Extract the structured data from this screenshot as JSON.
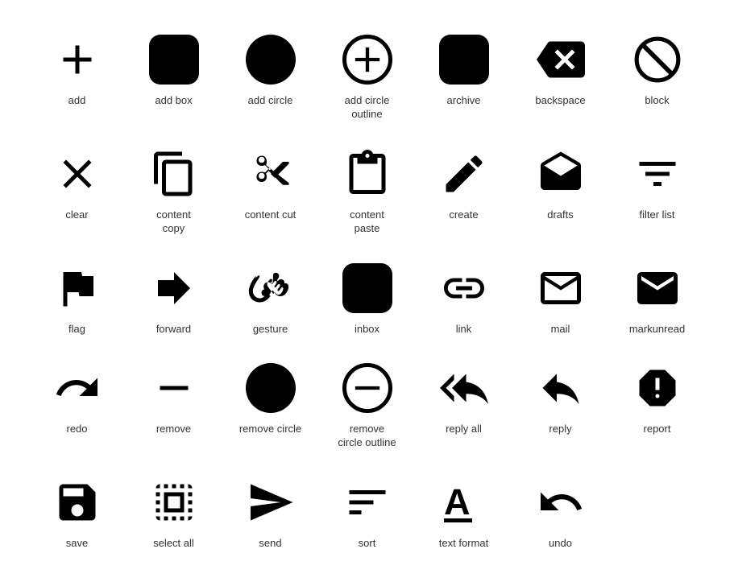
{
  "icons": [
    {
      "id": "add",
      "label": "add",
      "type": "plain"
    },
    {
      "id": "add-box",
      "label": "add box",
      "type": "rounded-sq"
    },
    {
      "id": "add-circle",
      "label": "add circle",
      "type": "circle-bg"
    },
    {
      "id": "add-circle-outline",
      "label": "add circle\noutline",
      "type": "circle-outline"
    },
    {
      "id": "archive",
      "label": "archive",
      "type": "rounded-sq"
    },
    {
      "id": "backspace",
      "label": "backspace",
      "type": "plain"
    },
    {
      "id": "block",
      "label": "block",
      "type": "circle-outline-slash"
    },
    {
      "id": "clear",
      "label": "clear",
      "type": "plain"
    },
    {
      "id": "content-copy",
      "label": "content\ncopy",
      "type": "plain"
    },
    {
      "id": "content-cut",
      "label": "content cut",
      "type": "plain"
    },
    {
      "id": "content-paste",
      "label": "content\npaste",
      "type": "plain"
    },
    {
      "id": "create",
      "label": "create",
      "type": "plain"
    },
    {
      "id": "drafts",
      "label": "drafts",
      "type": "plain"
    },
    {
      "id": "filter-list",
      "label": "filter list",
      "type": "plain"
    },
    {
      "id": "flag",
      "label": "flag",
      "type": "plain"
    },
    {
      "id": "forward",
      "label": "forward",
      "type": "plain"
    },
    {
      "id": "gesture",
      "label": "gesture",
      "type": "plain"
    },
    {
      "id": "inbox",
      "label": "inbox",
      "type": "rounded-sq"
    },
    {
      "id": "link",
      "label": "link",
      "type": "plain"
    },
    {
      "id": "mail",
      "label": "mail",
      "type": "plain"
    },
    {
      "id": "markunread",
      "label": "markunread",
      "type": "plain"
    },
    {
      "id": "redo",
      "label": "redo",
      "type": "plain"
    },
    {
      "id": "remove",
      "label": "remove",
      "type": "plain"
    },
    {
      "id": "remove-circle",
      "label": "remove circle",
      "type": "circle-bg"
    },
    {
      "id": "remove-circle-outline",
      "label": "remove\ncircle outline",
      "type": "circle-outline"
    },
    {
      "id": "reply-all",
      "label": "reply all",
      "type": "plain"
    },
    {
      "id": "reply",
      "label": "reply",
      "type": "plain"
    },
    {
      "id": "report",
      "label": "report",
      "type": "plain"
    },
    {
      "id": "save",
      "label": "save",
      "type": "plain"
    },
    {
      "id": "select-all",
      "label": "select all",
      "type": "plain"
    },
    {
      "id": "send",
      "label": "send",
      "type": "plain"
    },
    {
      "id": "sort",
      "label": "sort",
      "type": "plain"
    },
    {
      "id": "text-format",
      "label": "text format",
      "type": "plain"
    },
    {
      "id": "undo",
      "label": "undo",
      "type": "plain"
    }
  ]
}
